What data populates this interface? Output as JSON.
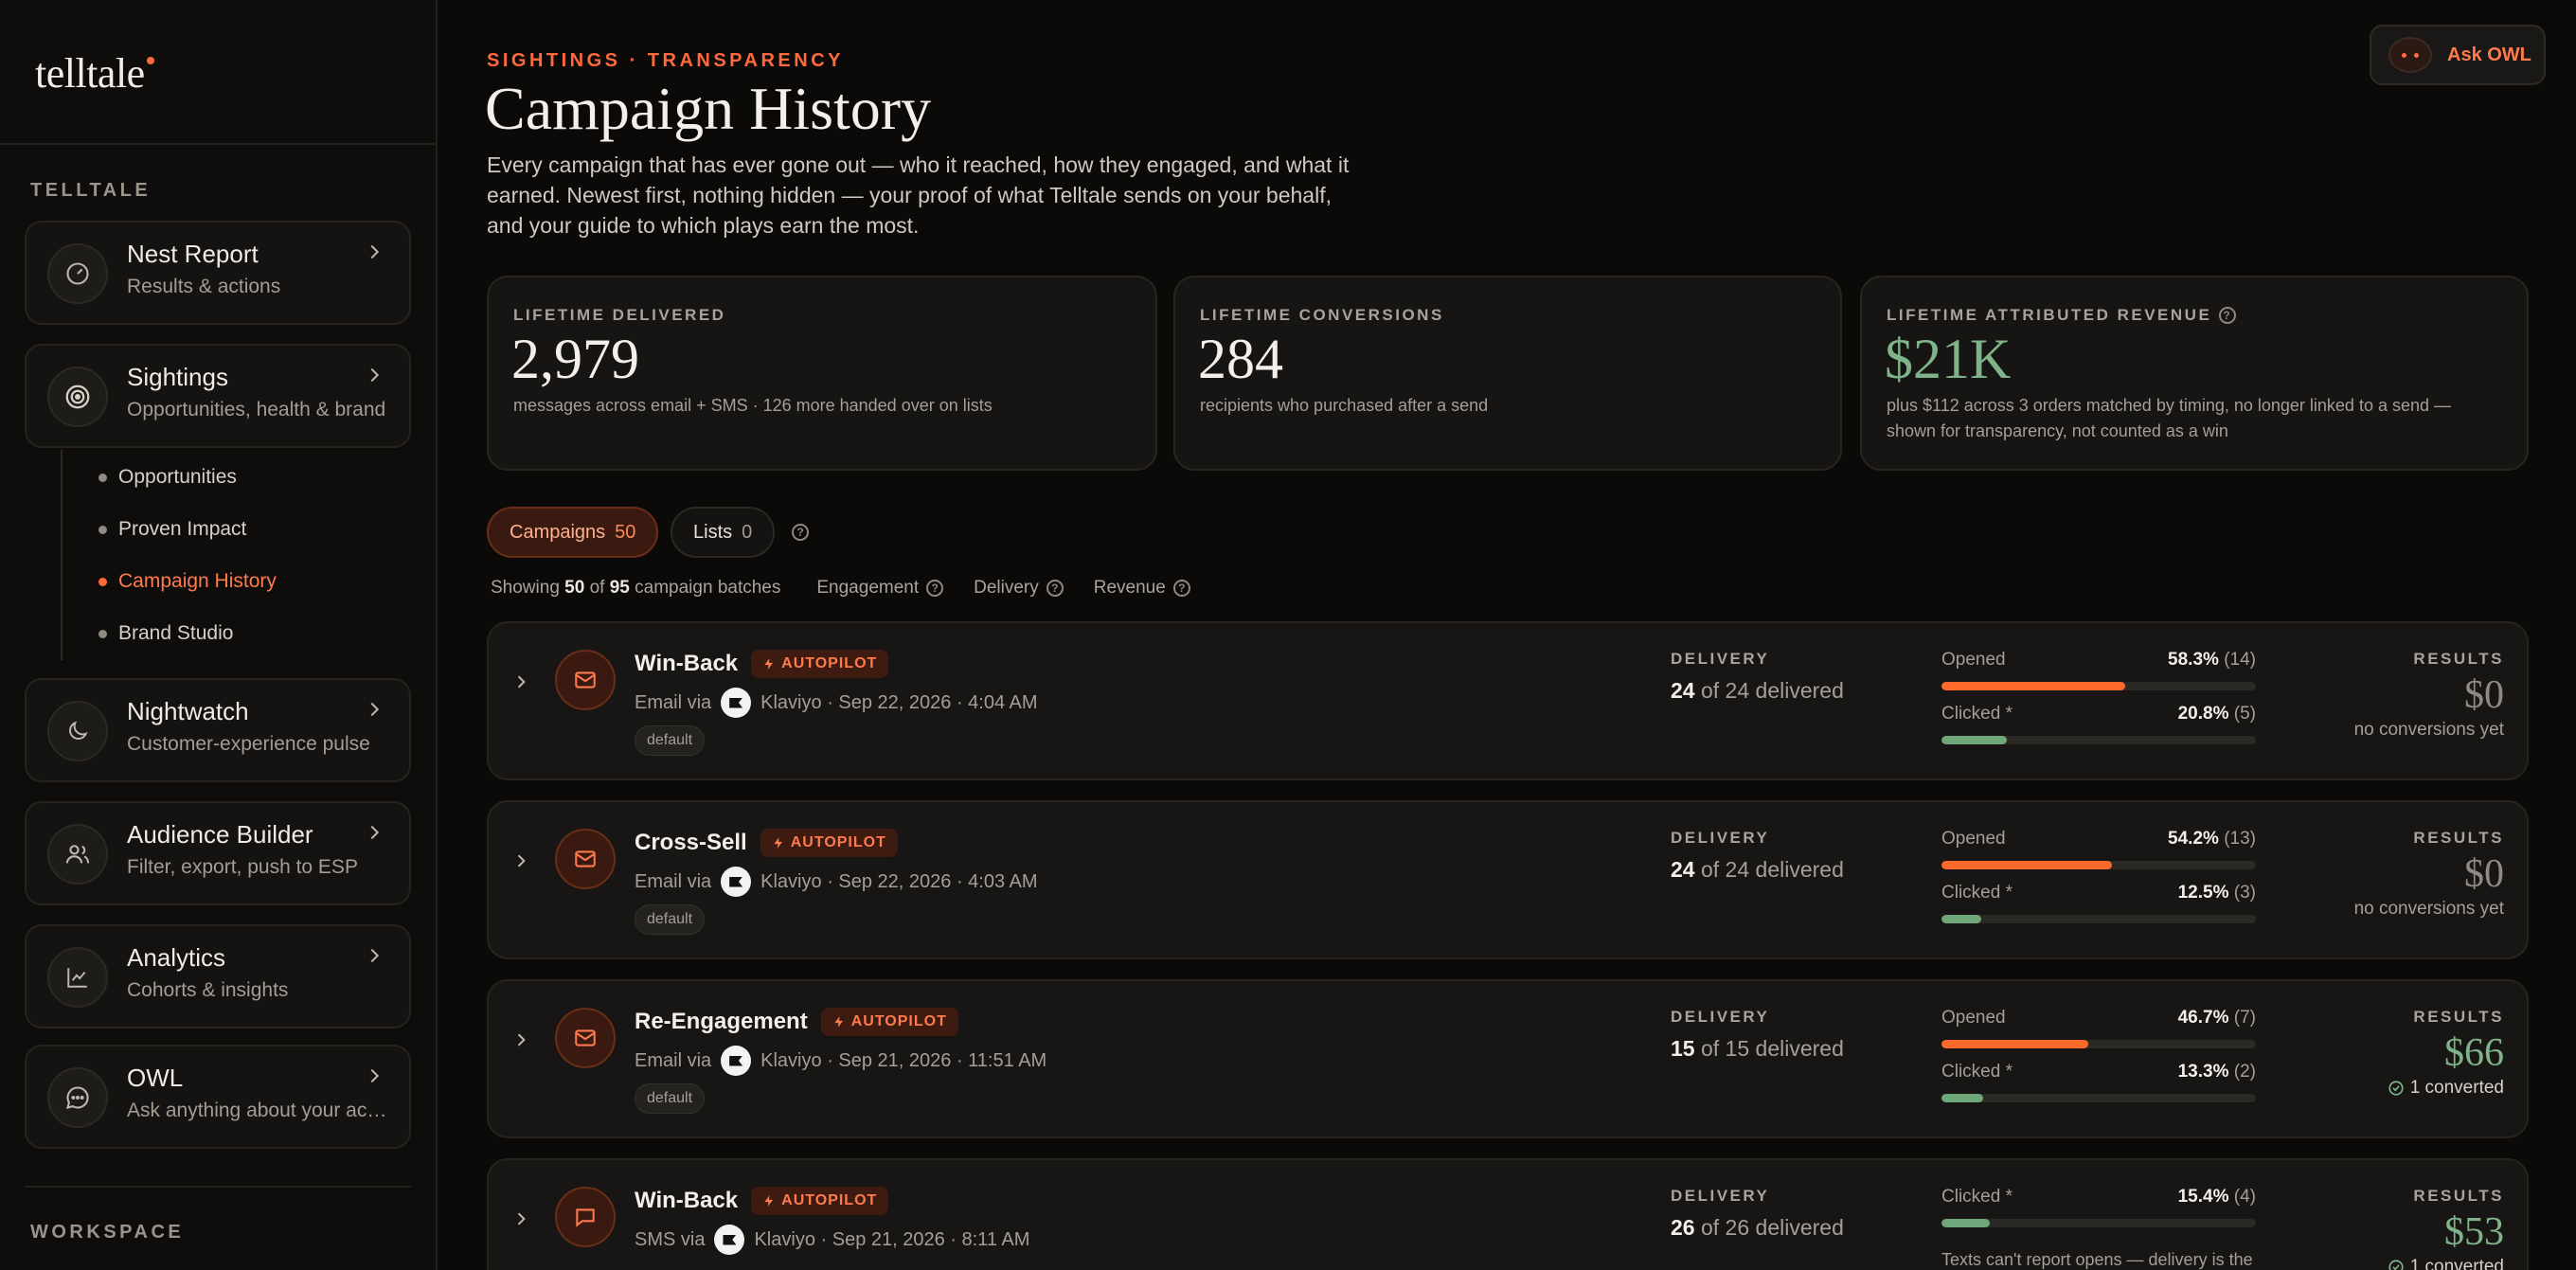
{
  "sidebar": {
    "logo": "telltale",
    "section_label": "TELLTALE",
    "items": [
      {
        "title": "Nest Report",
        "subtitle": "Results & actions",
        "icon": "gauge-icon"
      },
      {
        "title": "Sightings",
        "subtitle": "Opportunities, health & brand",
        "icon": "target-icon"
      },
      {
        "title": "Nightwatch",
        "subtitle": "Customer-experience pulse",
        "icon": "moon-icon"
      },
      {
        "title": "Audience Builder",
        "subtitle": "Filter, export, push to ESP",
        "icon": "users-icon"
      },
      {
        "title": "Analytics",
        "subtitle": "Cohorts & insights",
        "icon": "chart-icon"
      },
      {
        "title": "OWL",
        "subtitle": "Ask anything about your account",
        "icon": "chat-icon"
      }
    ],
    "subitems": [
      "Opportunities",
      "Proven Impact",
      "Campaign History",
      "Brand Studio"
    ],
    "active_subitem": "Campaign History",
    "workspace_label": "WORKSPACE"
  },
  "header": {
    "eyebrow": "SIGHTINGS · TRANSPARENCY",
    "title": "Campaign History",
    "description": "Every campaign that has ever gone out — who it reached, how they engaged, and what it earned. Newest first, nothing hidden — your proof of what Telltale sends on your behalf, and your guide to which plays earn the most.",
    "ask_owl": "Ask OWL"
  },
  "stats": [
    {
      "label": "LIFETIME DELIVERED",
      "value": "2,979",
      "note": "messages across email + SMS · 126 more handed over on lists"
    },
    {
      "label": "LIFETIME CONVERSIONS",
      "value": "284",
      "note": "recipients who purchased after a send"
    },
    {
      "label": "LIFETIME ATTRIBUTED REVENUE",
      "value": "$21K",
      "note": "plus $112 across 3 orders matched by timing, no longer linked to a send — shown for transparency, not counted as a win"
    }
  ],
  "tabs": [
    {
      "label": "Campaigns",
      "count": "50"
    },
    {
      "label": "Lists",
      "count": "0"
    }
  ],
  "filters": {
    "showing_prefix": "Showing",
    "shown": "50",
    "of_word": "of",
    "total": "95",
    "suffix": "campaign batches",
    "engagement": "Engagement",
    "delivery": "Delivery",
    "revenue": "Revenue"
  },
  "labels": {
    "autopilot": "AUTOPILOT",
    "delivery": "DELIVERY",
    "results": "RESULTS",
    "opened": "Opened",
    "clicked": "Clicked *"
  },
  "campaigns": [
    {
      "name": "Win-Back",
      "channel": "Email via",
      "provider": "Klaviyo",
      "date": "· Sep 22, 2026 · 4:04 AM",
      "tag": "default",
      "delivered": "24",
      "delivered_suffix": "of 24 delivered",
      "opened_pct": "58.3%",
      "opened_n": "(14)",
      "opened_frac": 0.583,
      "clicked_pct": "20.8%",
      "clicked_n": "(5)",
      "clicked_frac": 0.208,
      "revenue": "$0",
      "results_note": "no conversions yet"
    },
    {
      "name": "Cross-Sell",
      "channel": "Email via",
      "provider": "Klaviyo",
      "date": "· Sep 22, 2026 · 4:03 AM",
      "tag": "default",
      "delivered": "24",
      "delivered_suffix": "of 24 delivered",
      "opened_pct": "54.2%",
      "opened_n": "(13)",
      "opened_frac": 0.542,
      "clicked_pct": "12.5%",
      "clicked_n": "(3)",
      "clicked_frac": 0.125,
      "revenue": "$0",
      "results_note": "no conversions yet"
    },
    {
      "name": "Re-Engagement",
      "channel": "Email via",
      "provider": "Klaviyo",
      "date": "· Sep 21, 2026 · 11:51 AM",
      "tag": "default",
      "delivered": "15",
      "delivered_suffix": "of 15 delivered",
      "opened_pct": "46.7%",
      "opened_n": "(7)",
      "opened_frac": 0.467,
      "clicked_pct": "13.3%",
      "clicked_n": "(2)",
      "clicked_frac": 0.133,
      "revenue": "$66",
      "results_note": "1 converted"
    },
    {
      "name": "Win-Back",
      "channel": "SMS via",
      "provider": "Klaviyo",
      "date": "· Sep 21, 2026 · 8:11 AM",
      "delivered": "26",
      "delivered_suffix": "of 26 delivered",
      "clicked_pct": "15.4%",
      "clicked_n": "(4)",
      "clicked_frac": 0.154,
      "sms_note": "Texts can't report opens — delivery is the",
      "revenue": "$53",
      "results_note": "1 converted"
    }
  ]
}
